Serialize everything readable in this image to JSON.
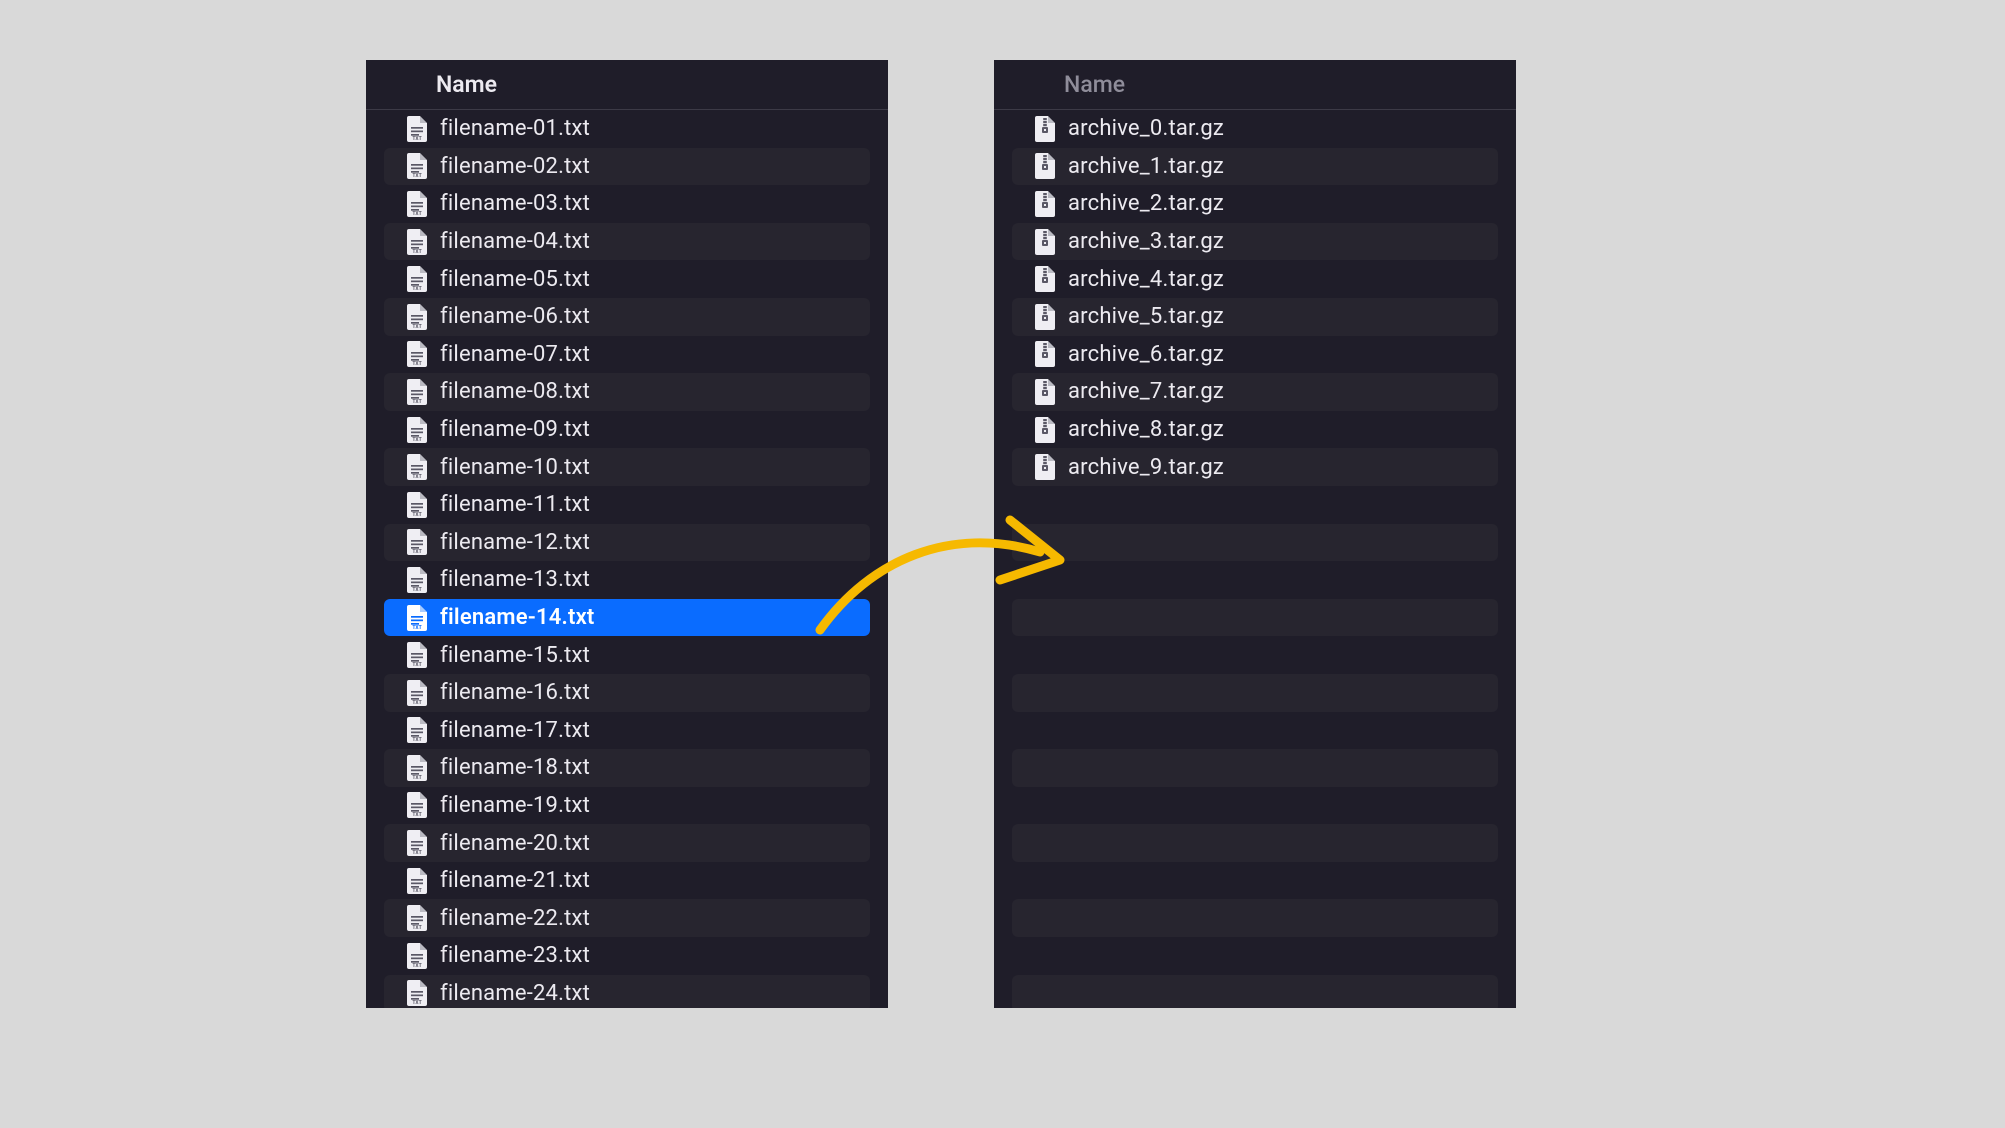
{
  "left": {
    "header": "Name",
    "header_active": true,
    "icon_kind": "txt",
    "selected_index": 13,
    "files": [
      "filename-01.txt",
      "filename-02.txt",
      "filename-03.txt",
      "filename-04.txt",
      "filename-05.txt",
      "filename-06.txt",
      "filename-07.txt",
      "filename-08.txt",
      "filename-09.txt",
      "filename-10.txt",
      "filename-11.txt",
      "filename-12.txt",
      "filename-13.txt",
      "filename-14.txt",
      "filename-15.txt",
      "filename-16.txt",
      "filename-17.txt",
      "filename-18.txt",
      "filename-19.txt",
      "filename-20.txt",
      "filename-21.txt",
      "filename-22.txt",
      "filename-23.txt",
      "filename-24.txt"
    ]
  },
  "right": {
    "header": "Name",
    "header_active": false,
    "icon_kind": "archive",
    "selected_index": -1,
    "empty_rows_after": 14,
    "files": [
      "archive_0.tar.gz",
      "archive_1.tar.gz",
      "archive_2.tar.gz",
      "archive_3.tar.gz",
      "archive_4.tar.gz",
      "archive_5.tar.gz",
      "archive_6.tar.gz",
      "archive_7.tar.gz",
      "archive_8.tar.gz",
      "archive_9.tar.gz"
    ]
  },
  "annotation": {
    "arrow_color": "#f6b900"
  }
}
